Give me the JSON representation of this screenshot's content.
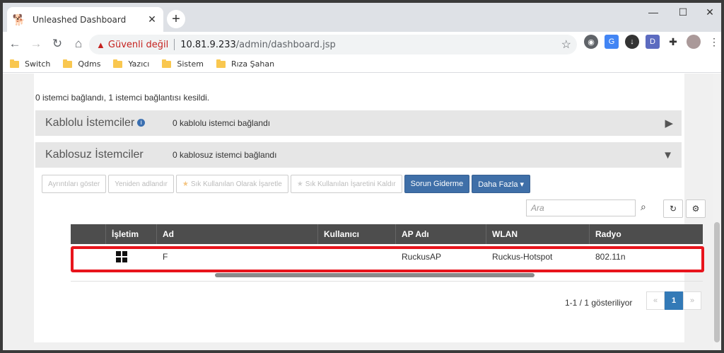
{
  "browser": {
    "tab_title": "Unleashed Dashboard",
    "tab_close": "✕",
    "new_tab": "+",
    "security_label": "Güvenli değil",
    "url_host": "10.81.9.233",
    "url_path": "/admin/dashboard.jsp",
    "bookmarks": [
      "Switch",
      "Qdms",
      "Yazıcı",
      "Sistem",
      "Rıza Şahan"
    ]
  },
  "page": {
    "summary": "0 istemci bağlandı, 1 istemci bağlantısı kesildi.",
    "wired": {
      "title": "Kablolu İstemciler",
      "desc": "0 kablolu istemci bağlandı"
    },
    "wireless": {
      "title": "Kablosuz İstemciler",
      "desc": "0 kablosuz istemci bağlandı"
    },
    "buttons": {
      "details": "Ayrıntıları göster",
      "rename": "Yeniden adlandır",
      "mark_fav": "Sık Kullanılan Olarak İşaretle",
      "unmark_fav": "Sık Kullanılan İşaretini Kaldır",
      "troubleshoot": "Sorun Giderme",
      "more": "Daha Fazla ▾"
    },
    "search_placeholder": "Ara",
    "table": {
      "headers": [
        "",
        "İşletim",
        "Ad",
        "Kullanıcı",
        "AP Adı",
        "WLAN",
        "Radyo"
      ],
      "row": {
        "os": "windows-icon",
        "name": "F",
        "user": "",
        "ap": "RuckusAP",
        "wlan": "Ruckus-Hotspot",
        "radio": "802.11n"
      }
    },
    "paging_text": "1-1 / 1 gösteriliyor",
    "pager": {
      "prev": "«",
      "current": "1",
      "next": "»"
    }
  }
}
